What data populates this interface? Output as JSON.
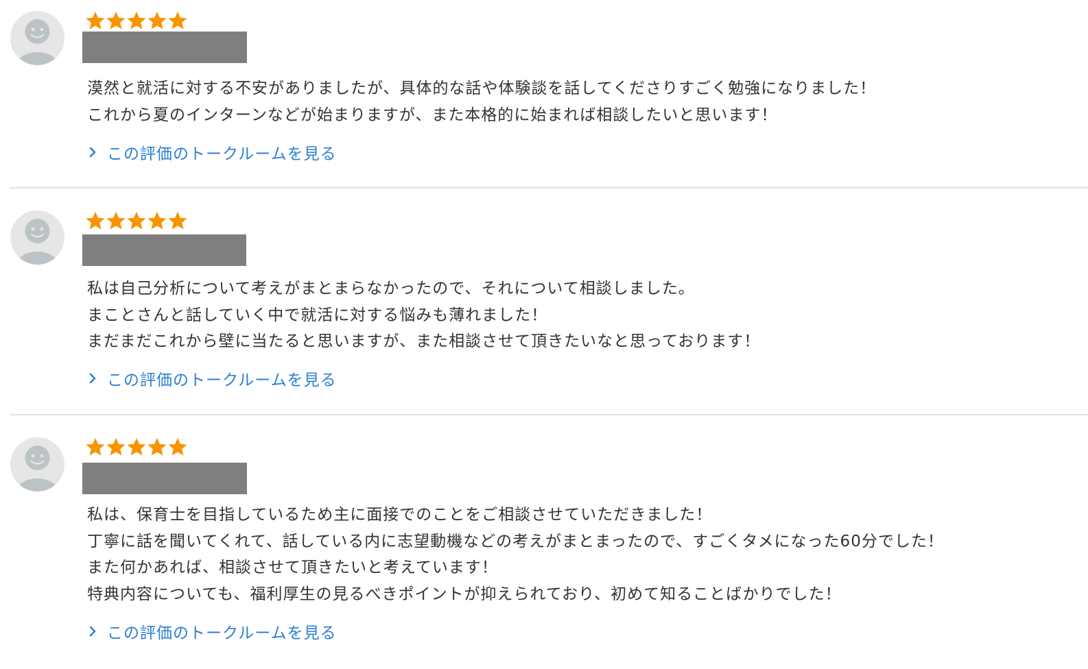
{
  "colors": {
    "star": "#f79400",
    "link": "#2b7fd4",
    "redacted": "#7f7f7f",
    "avatar_bg": "#e6e6e6",
    "avatar_fg": "#bcc3c6",
    "divider": "#e3e3e3"
  },
  "reviews": [
    {
      "rating": 5,
      "lines": [
        "漠然と就活に対する不安がありましたが、具体的な話や体験談を話してくださりすごく勉強になりました！",
        "これから夏のインターンなどが始まりますが、また本格的に始まれば相談したいと思います！"
      ],
      "link_label": "この評価のトークルームを見る"
    },
    {
      "rating": 5,
      "lines": [
        "私は自己分析について考えがまとまらなかったので、それについて相談しました。",
        "まことさんと話していく中で就活に対する悩みも薄れました！",
        "まだまだこれから壁に当たると思いますが、また相談させて頂きたいなと思っております！"
      ],
      "link_label": "この評価のトークルームを見る"
    },
    {
      "rating": 5,
      "lines": [
        "私は、保育士を目指しているため主に面接でのことをご相談させていただきました！",
        "丁寧に話を聞いてくれて、話している内に志望動機などの考えがまとまったので、すごくタメになった60分でした！",
        "また何かあれば、相談させて頂きたいと考えています！",
        "特典内容についても、福利厚生の見るべきポイントが抑えられており、初めて知ることばかりでした！"
      ],
      "link_label": "この評価のトークルームを見る"
    }
  ]
}
